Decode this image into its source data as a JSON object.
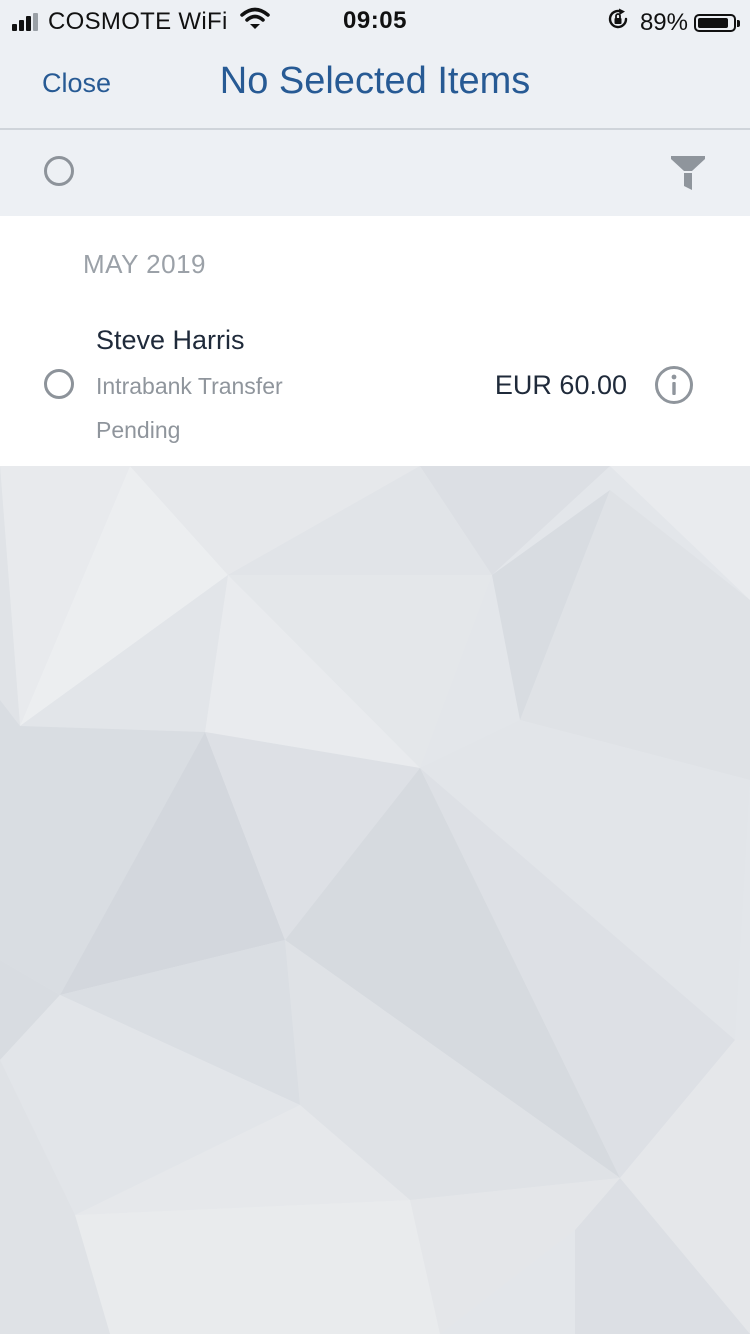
{
  "status_bar": {
    "carrier": "COSMOTE WiFi",
    "time": "09:05",
    "battery_percent": "89%",
    "battery_level": 0.89,
    "signal_bars_active": 3,
    "signal_bars_total": 4,
    "icons": [
      "wifi-icon",
      "rotation-lock-icon",
      "battery-icon"
    ]
  },
  "nav": {
    "close_label": "Close",
    "title": "No Selected Items"
  },
  "toolbar": {
    "select_all_icon": "radio-circle-icon",
    "filter_icon": "filter-funnel-icon"
  },
  "list": {
    "month_header": "MAY 2019",
    "transactions": [
      {
        "name": "Steve Harris",
        "type": "Intrabank Transfer",
        "status": "Pending",
        "amount": "EUR 60.00",
        "selected": false,
        "info_icon": "info-icon"
      }
    ]
  },
  "colors": {
    "accent": "#275a94",
    "text_dark": "#1f2a3a",
    "text_muted": "#8f959c",
    "header_bg": "#edf0f4",
    "background": "#e4e7eb"
  }
}
